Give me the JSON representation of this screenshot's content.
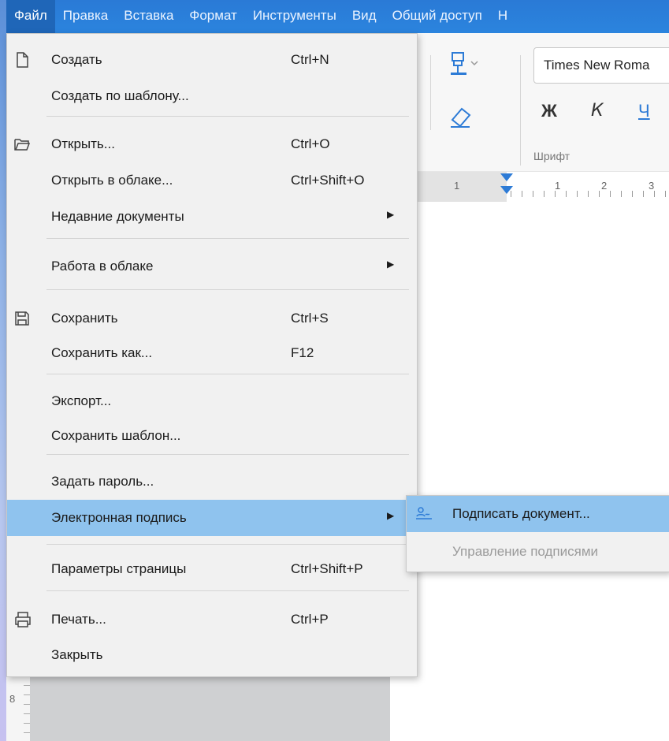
{
  "menubar": {
    "items": [
      "Файл",
      "Правка",
      "Вставка",
      "Формат",
      "Инструменты",
      "Вид",
      "Общий доступ",
      "Н"
    ]
  },
  "toolbar": {
    "font_name": "Times New Roma",
    "bold_label": "Ж",
    "italic_label": "К",
    "underline_label": "Ч",
    "font_group_label": "Шрифт"
  },
  "ruler": {
    "numbers": [
      "1",
      "1",
      "2",
      "3"
    ],
    "left_number": "8"
  },
  "file_menu": {
    "items": [
      {
        "label": "Создать",
        "shortcut": "Ctrl+N",
        "icon": "new-document-icon"
      },
      {
        "label": "Создать по шаблону...",
        "shortcut": ""
      },
      {
        "label": "Открыть...",
        "shortcut": "Ctrl+O",
        "icon": "open-folder-icon"
      },
      {
        "label": "Открыть в облаке...",
        "shortcut": "Ctrl+Shift+O"
      },
      {
        "label": "Недавние документы",
        "shortcut": "",
        "submenu": true
      },
      {
        "label": "Работа в облаке",
        "shortcut": "",
        "submenu": true
      },
      {
        "label": "Сохранить",
        "shortcut": "Ctrl+S",
        "icon": "save-icon"
      },
      {
        "label": "Сохранить как...",
        "shortcut": "F12"
      },
      {
        "label": "Экспорт...",
        "shortcut": ""
      },
      {
        "label": "Сохранить шаблон...",
        "shortcut": ""
      },
      {
        "label": "Задать пароль...",
        "shortcut": ""
      },
      {
        "label": "Электронная подпись",
        "shortcut": "",
        "submenu": true,
        "highlighted": true
      },
      {
        "label": "Параметры страницы",
        "shortcut": "Ctrl+Shift+P"
      },
      {
        "label": "Печать...",
        "shortcut": "Ctrl+P",
        "icon": "printer-icon"
      },
      {
        "label": "Закрыть",
        "shortcut": ""
      }
    ]
  },
  "signature_submenu": {
    "items": [
      {
        "label": "Подписать документ...",
        "icon": "sign-document-icon",
        "highlighted": true,
        "enabled": true
      },
      {
        "label": "Управление подписями",
        "enabled": false
      }
    ]
  },
  "colors": {
    "menubar": "#2b84de",
    "highlight": "#8fc3ee",
    "menu_bg": "#f1f1f1",
    "accent": "#2d7bd6"
  }
}
